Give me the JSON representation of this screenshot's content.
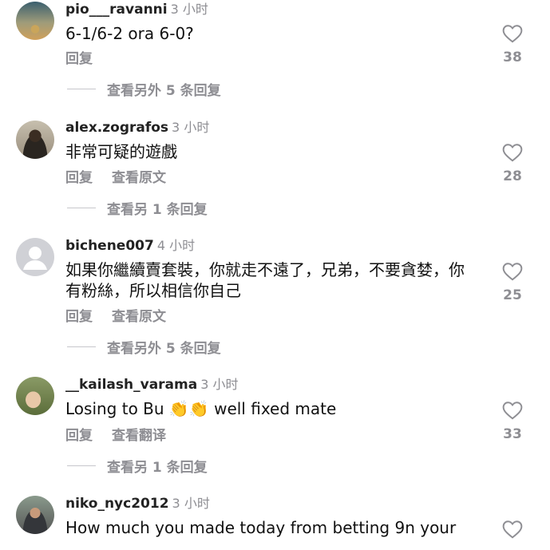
{
  "comments": [
    {
      "username": "pio___ravanni",
      "time": "3 小时",
      "text": "6-1/6-2 ora 6-0?",
      "actions": [
        "回复"
      ],
      "likes": "38",
      "replies_link": "查看另外 5 条回复",
      "avatar": "sunset-photo-avatar"
    },
    {
      "username": "alex.zografos",
      "time": "3 小时",
      "text": "非常可疑的遊戲",
      "actions": [
        "回复",
        "查看原文"
      ],
      "likes": "28",
      "replies_link": "查看另 1 条回复",
      "avatar": "man-photo-avatar"
    },
    {
      "username": "bichene007",
      "time": "4 小时",
      "text": "如果你繼續賣套裝，你就走不遠了，兄弟，不要貪婪，你有粉絲，所以相信你自己",
      "actions": [
        "回复",
        "查看原文"
      ],
      "likes": "25",
      "replies_link": "查看另外 5 条回复",
      "avatar": "default-avatar"
    },
    {
      "username": "__kailash_varama",
      "time": "3 小时",
      "text_before": "Losing to Bu ",
      "emoji": "👏👏",
      "text_after": " well fixed mate",
      "actions": [
        "回复",
        "查看翻译"
      ],
      "likes": "33",
      "replies_link": "查看另 1 条回复",
      "avatar": "hands-photo-avatar"
    },
    {
      "username": "niko_nyc2012",
      "time": "3 小时",
      "text": "How much you made today from betting 9n your",
      "avatar": "car-photo-avatar"
    }
  ],
  "colors": {
    "secondary_text": "#8e8e93",
    "primary_text": "#111111",
    "divider": "#c7c7cc"
  }
}
